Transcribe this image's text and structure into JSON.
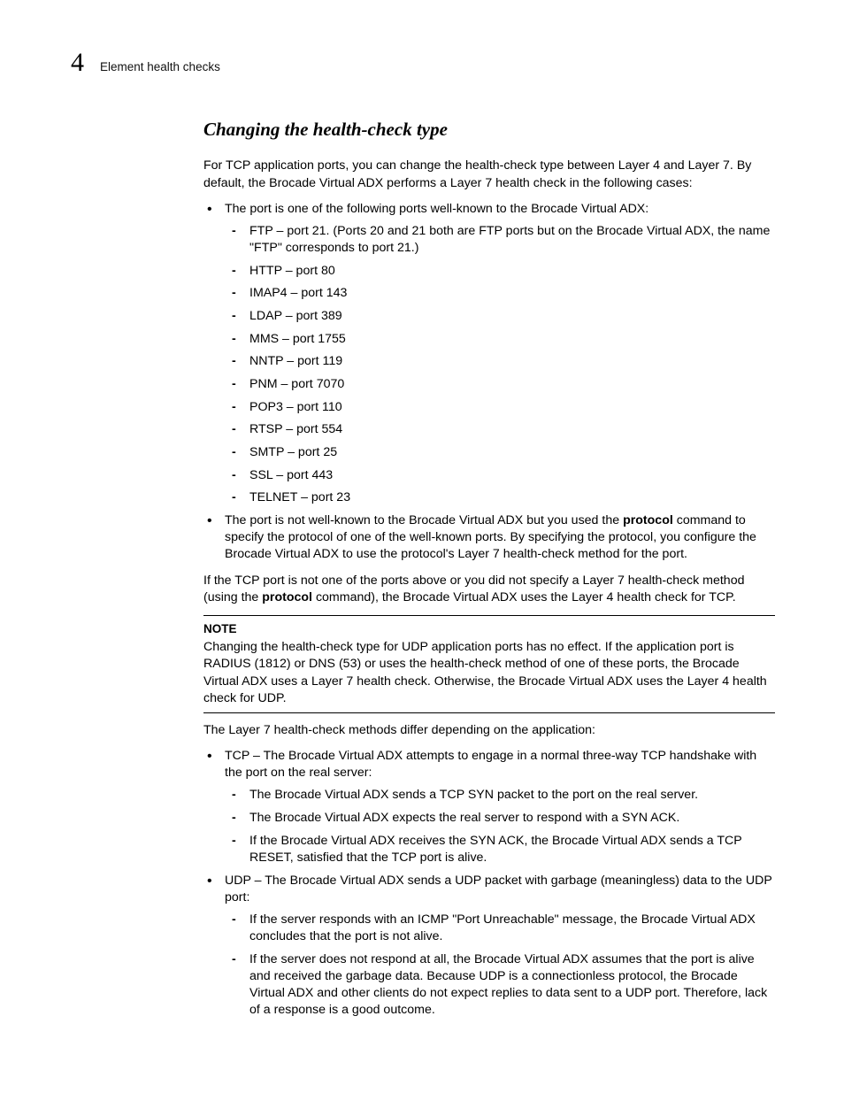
{
  "header": {
    "chapter_number": "4",
    "running_title": "Element health checks"
  },
  "section": {
    "heading": "Changing the health-check type",
    "intro": "For TCP application ports, you can change the health-check type between Layer 4 and Layer 7. By default, the Brocade Virtual ADX performs a Layer 7 health check in the following cases:",
    "case1_lead": "The port is one of the following ports well-known to the Brocade Virtual ADX:",
    "ports": [
      "FTP – port 21. (Ports 20 and 21 both are FTP ports but on the Brocade Virtual ADX, the name \"FTP\" corresponds to port 21.)",
      "HTTP – port 80",
      "IMAP4 – port 143",
      "LDAP – port 389",
      "MMS – port 1755",
      "NNTP – port 119",
      "PNM – port 7070",
      "POP3 – port 110",
      "RTSP – port 554",
      "SMTP – port 25",
      "SSL – port 443",
      "TELNET – port 23"
    ],
    "case2_pre": "The port is not well-known to the Brocade Virtual ADX but you used the ",
    "case2_bold": "protocol",
    "case2_post": " command to specify the protocol of one of the well-known ports. By specifying the protocol, you configure the Brocade Virtual ADX to use the protocol's Layer 7 health-check method for the port.",
    "fallback_pre": "If the TCP port is not one of the ports above or you did not specify a Layer 7 health-check method (using the ",
    "fallback_bold": "protocol",
    "fallback_post": " command), the Brocade Virtual ADX uses the Layer 4 health check for TCP.",
    "note_heading": "NOTE",
    "note_body": "Changing the health-check type for UDP application ports has no effect. If the application port is RADIUS (1812) or DNS (53) or uses the health-check method of one of these ports, the Brocade Virtual ADX uses a Layer 7 health check. Otherwise, the Brocade Virtual ADX uses the Layer 4 health check for UDP.",
    "l7_intro": "The Layer 7 health-check methods differ depending on the application:",
    "tcp_lead": "TCP – The Brocade Virtual ADX attempts to engage in a normal three-way TCP handshake with the port on the real server:",
    "tcp_steps": [
      "The Brocade Virtual ADX sends a TCP SYN packet to the port on the real server.",
      "The Brocade Virtual ADX expects the real server to respond with a SYN ACK.",
      "If the Brocade Virtual ADX receives the SYN ACK, the Brocade Virtual ADX sends a TCP RESET, satisfied that the TCP port is alive."
    ],
    "udp_lead": "UDP – The Brocade Virtual ADX sends a UDP packet with garbage (meaningless) data to the UDP port:",
    "udp_steps": [
      "If the server responds with an ICMP \"Port Unreachable\" message, the Brocade Virtual ADX concludes that the port is not alive.",
      "If the server does not respond at all, the Brocade Virtual ADX assumes that the port is alive and received the garbage data. Because UDP is a connectionless protocol, the Brocade Virtual ADX and other clients do not expect replies to data sent to a UDP port. Therefore, lack of a response is a good outcome."
    ]
  }
}
